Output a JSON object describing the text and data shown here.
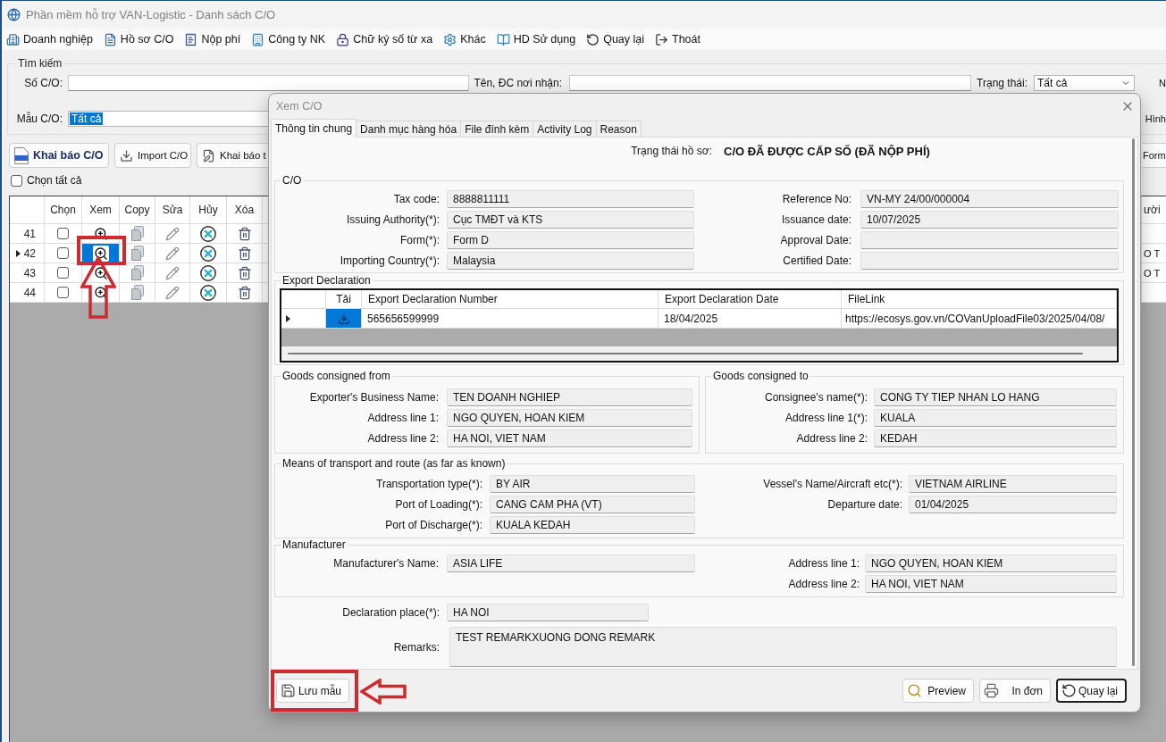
{
  "window": {
    "title": "Phần mềm hỗ trợ VAN-Logistic - Danh sách C/O"
  },
  "menu": [
    "Doanh nghiệp",
    "Hồ sơ C/O",
    "Nộp phí",
    "Công ty NK",
    "Chữ ký số từ xa",
    "Khác",
    "HD Sử dụng",
    "Quay lại",
    "Thoát"
  ],
  "search": {
    "title": "Tìm kiếm",
    "co_number": {
      "label": "Số C/O:"
    },
    "recipient": {
      "label": "Tên, ĐC nơi nhận:"
    },
    "status": {
      "label": "Trạng thái:",
      "value": "Tất cả"
    },
    "cut_off_label_1": "N",
    "form": {
      "label": "Mẫu C/O:",
      "value": "Tất cả",
      "text_selected": true
    },
    "cut_off_label_2": "Hình"
  },
  "toolbar": {
    "buttons": [
      {
        "label": "Khai báo C/O",
        "primary": true
      },
      {
        "label": "Import C/O",
        "primary": false
      },
      {
        "label": "Khai báo t",
        "primary": false
      }
    ],
    "cut_off_button": "Form"
  },
  "select_all": {
    "label": "Chọn tất cả",
    "checked": false
  },
  "grid": {
    "columns": [
      "Chọn",
      "Xem",
      "Copy",
      "Sửa",
      "Hủy",
      "Xóa"
    ],
    "cut_off_column": "ười",
    "rows": [
      {
        "number": "41",
        "checked": false,
        "selected": false
      },
      {
        "number": "42",
        "checked": false,
        "selected": true,
        "cut_off_text": "O T"
      },
      {
        "number": "43",
        "checked": false,
        "selected": false,
        "cut_off_text": "O T"
      },
      {
        "number": "44",
        "checked": false,
        "selected": false
      }
    ]
  },
  "dialog": {
    "title": "Xem C/O",
    "tabs": [
      {
        "label": "Thông tin chung",
        "selected": true
      },
      {
        "label": "Danh mục hàng hóa",
        "selected": false
      },
      {
        "label": "File đính kèm",
        "selected": false
      },
      {
        "label": "Activity Log",
        "selected": false
      },
      {
        "label": "Reason",
        "selected": false
      }
    ],
    "status": {
      "label": "Trạng thái hồ sơ:",
      "value": "C/O ĐÃ ĐƯỢC CẤP SỐ (ĐÃ NỘP PHÍ)"
    },
    "co": {
      "title": "C/O",
      "left": [
        {
          "label": "Tax code:",
          "value": "8888811111"
        },
        {
          "label": "Issuing Authority(*):",
          "value": "Cục TMĐT và KTS"
        },
        {
          "label": "Form(*):",
          "value": "Form D"
        },
        {
          "label": "Importing Country(*):",
          "value": "Malaysia"
        }
      ],
      "right": [
        {
          "label": "Reference No:",
          "value": "VN-MY 24/00/000004"
        },
        {
          "label": "Issuance date:",
          "value": "10/07/2025"
        },
        {
          "label": "Approval Date:"
        },
        {
          "label": "Certified Date:"
        }
      ]
    },
    "export_declaration": {
      "title": "Export Declaration",
      "columns": [
        "Tải",
        "Export Declaration Number",
        "Export Declaration Date",
        "FileLink"
      ],
      "rows": [
        {
          "selected": true,
          "cells": [
            "",
            "565656599999",
            "18/04/2025",
            "https://ecosys.gov.vn/COVanUploadFile03/2025/04/08/"
          ]
        }
      ]
    },
    "goods_from": {
      "title": "Goods consigned from",
      "fields": [
        {
          "label": "Exporter's Business Name:",
          "value": "TEN DOANH NGHIEP"
        },
        {
          "label": "Address line 1:",
          "value": "NGO QUYEN, HOAN KIEM"
        },
        {
          "label": "Address line 2:",
          "value": "HA NOI, VIET NAM"
        }
      ]
    },
    "goods_to": {
      "title": "Goods consigned to",
      "fields": [
        {
          "label": "Consignee's name(*):",
          "value": "CONG TY TIEP NHAN LO HANG"
        },
        {
          "label": "Address line 1(*):",
          "value": "KUALA"
        },
        {
          "label": "Address line 2:",
          "value": "KEDAH"
        }
      ]
    },
    "transport": {
      "title": "Means of transport and route (as far as known)",
      "left": [
        {
          "label": "Transportation type(*):",
          "value": "BY AIR"
        },
        {
          "label": "Port of Loading(*):",
          "value": "CANG CAM PHA (VT)"
        },
        {
          "label": "Port of Discharge(*):",
          "value": "KUALA KEDAH"
        }
      ],
      "right": [
        {
          "label": "Vessel's Name/Aircraft etc(*):",
          "value": "VIETNAM AIRLINE"
        },
        {
          "label": "Departure date:",
          "value": "01/04/2025"
        }
      ]
    },
    "manufacturer": {
      "title": "Manufacturer",
      "left": [
        {
          "label": "Manufacturer's Name:",
          "value": "ASIA LIFE"
        }
      ],
      "right": [
        {
          "label": "Address line 1:",
          "value": "NGO QUYEN, HOAN KIEM"
        },
        {
          "label": "Address line 2:",
          "value": "HA NOI, VIET NAM"
        }
      ]
    },
    "declaration_place": {
      "label": "Declaration place(*):",
      "value": "HA NOI"
    },
    "remarks": {
      "label": "Remarks:",
      "value": "TEST REMARKXUONG DONG REMARK"
    },
    "left_buttons": [
      {
        "label": "Lưu mẫu",
        "focused": false
      }
    ],
    "right_buttons": [
      {
        "label": "Preview",
        "focused": false
      },
      {
        "label": "In đơn",
        "focused": false
      },
      {
        "label": "Quay lại",
        "focused": true
      }
    ]
  }
}
